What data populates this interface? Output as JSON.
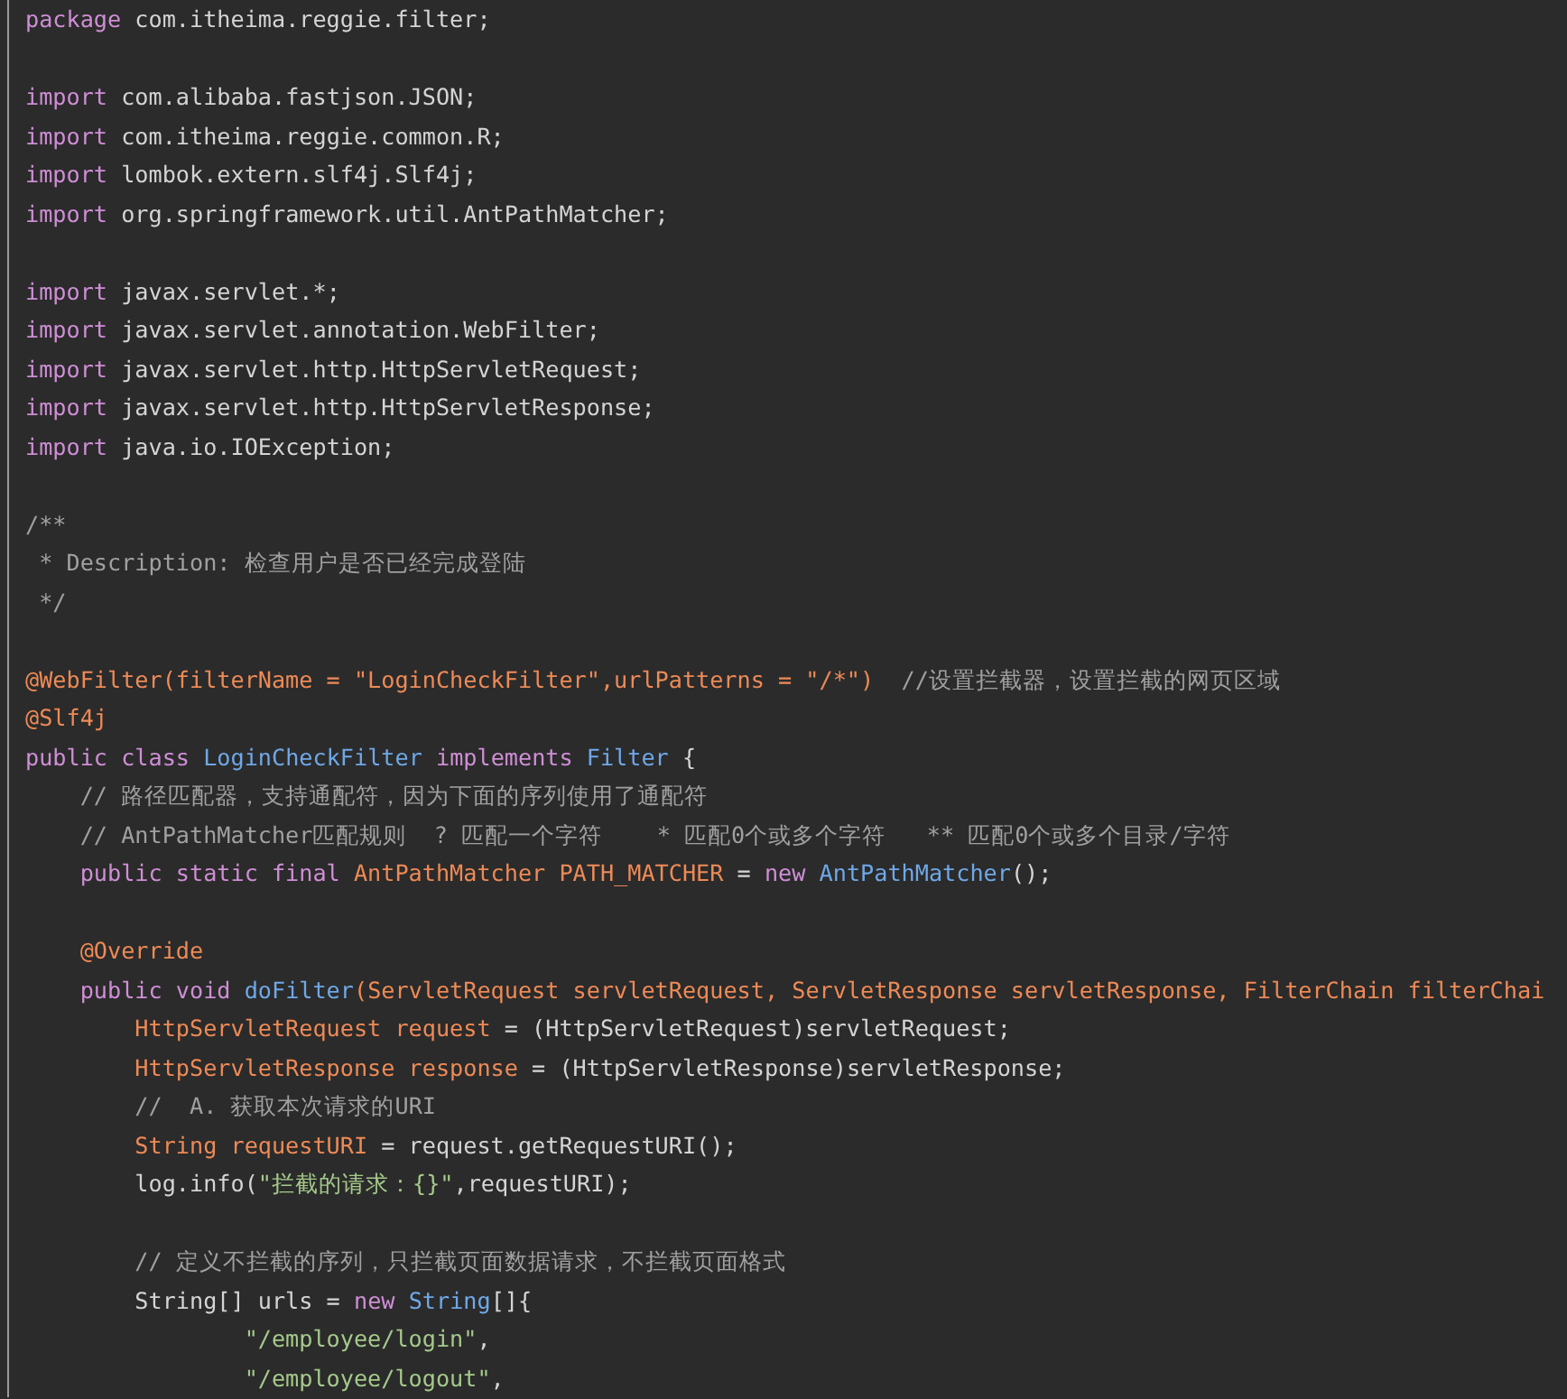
{
  "editor": {
    "lines": [
      {
        "kind": "code",
        "tokens": [
          {
            "text": "package",
            "kind": "kw"
          },
          {
            "text": " com.itheima.reggie.filter;",
            "kind": "plain"
          }
        ]
      },
      {
        "kind": "blank"
      },
      {
        "kind": "code",
        "tokens": [
          {
            "text": "import",
            "kind": "kw"
          },
          {
            "text": " com.alibaba.fastjson.JSON;",
            "kind": "plain"
          }
        ]
      },
      {
        "kind": "code",
        "tokens": [
          {
            "text": "import",
            "kind": "kw"
          },
          {
            "text": " com.itheima.reggie.common.R;",
            "kind": "plain"
          }
        ]
      },
      {
        "kind": "code",
        "tokens": [
          {
            "text": "import",
            "kind": "kw"
          },
          {
            "text": " lombok.extern.slf4j.Slf4j;",
            "kind": "plain"
          }
        ]
      },
      {
        "kind": "code",
        "tokens": [
          {
            "text": "import",
            "kind": "kw"
          },
          {
            "text": " org.springframework.util.AntPathMatcher;",
            "kind": "plain"
          }
        ]
      },
      {
        "kind": "blank"
      },
      {
        "kind": "code",
        "tokens": [
          {
            "text": "import",
            "kind": "kw"
          },
          {
            "text": " javax.servlet.*;",
            "kind": "plain"
          }
        ]
      },
      {
        "kind": "code",
        "tokens": [
          {
            "text": "import",
            "kind": "kw"
          },
          {
            "text": " javax.servlet.annotation.WebFilter;",
            "kind": "plain"
          }
        ]
      },
      {
        "kind": "code",
        "tokens": [
          {
            "text": "import",
            "kind": "kw"
          },
          {
            "text": " javax.servlet.http.HttpServletRequest;",
            "kind": "plain"
          }
        ]
      },
      {
        "kind": "code",
        "tokens": [
          {
            "text": "import",
            "kind": "kw"
          },
          {
            "text": " javax.servlet.http.HttpServletResponse;",
            "kind": "plain"
          }
        ]
      },
      {
        "kind": "code",
        "tokens": [
          {
            "text": "import",
            "kind": "kw"
          },
          {
            "text": " java.io.IOException;",
            "kind": "plain"
          }
        ]
      },
      {
        "kind": "blank"
      },
      {
        "kind": "code",
        "tokens": [
          {
            "text": "/**",
            "kind": "cmt"
          }
        ]
      },
      {
        "kind": "code",
        "tokens": [
          {
            "text": " * Description: 检查用户是否已经完成登陆",
            "kind": "cmt"
          }
        ]
      },
      {
        "kind": "code",
        "tokens": [
          {
            "text": " */",
            "kind": "cmt"
          }
        ]
      },
      {
        "kind": "blank"
      },
      {
        "kind": "code",
        "tokens": [
          {
            "text": "@WebFilter(filterName = \"LoginCheckFilter\",urlPatterns = \"/*\")",
            "kind": "decl"
          },
          {
            "text": "  //设置拦截器，设置拦截的网页区域",
            "kind": "cmt"
          }
        ]
      },
      {
        "kind": "code",
        "tokens": [
          {
            "text": "@Slf4j",
            "kind": "decl"
          }
        ]
      },
      {
        "kind": "code",
        "tokens": [
          {
            "text": "public class",
            "kind": "kw"
          },
          {
            "text": " LoginCheckFilter",
            "kind": "type"
          },
          {
            "text": " implements",
            "kind": "kw"
          },
          {
            "text": " Filter",
            "kind": "type"
          },
          {
            "text": " {",
            "kind": "plain"
          }
        ]
      },
      {
        "kind": "code",
        "tokens": [
          {
            "text": "    // 路径匹配器，支持通配符，因为下面的序列使用了通配符",
            "kind": "cmt"
          }
        ]
      },
      {
        "kind": "code",
        "tokens": [
          {
            "text": "    // AntPathMatcher匹配规则  ? 匹配一个字符    * 匹配0个或多个字符   ** 匹配0个或多个目录/字符",
            "kind": "cmt"
          }
        ]
      },
      {
        "kind": "code",
        "tokens": [
          {
            "text": "    public static final",
            "kind": "kw"
          },
          {
            "text": " AntPathMatcher PATH_MATCHER",
            "kind": "decl"
          },
          {
            "text": " = ",
            "kind": "plain"
          },
          {
            "text": "new",
            "kind": "kw"
          },
          {
            "text": " AntPathMatcher",
            "kind": "type"
          },
          {
            "text": "();",
            "kind": "plain"
          }
        ]
      },
      {
        "kind": "blank"
      },
      {
        "kind": "code",
        "tokens": [
          {
            "text": "    @Override",
            "kind": "decl"
          }
        ]
      },
      {
        "kind": "code",
        "tokens": [
          {
            "text": "    public void",
            "kind": "kw"
          },
          {
            "text": " doFilter",
            "kind": "type"
          },
          {
            "text": "(ServletRequest servletRequest, ServletResponse servletResponse, FilterChain filterChai",
            "kind": "decl"
          }
        ]
      },
      {
        "kind": "code",
        "tokens": [
          {
            "text": "        HttpServletRequest request",
            "kind": "decl"
          },
          {
            "text": " = (HttpServletRequest)servletRequest;",
            "kind": "plain"
          }
        ]
      },
      {
        "kind": "code",
        "tokens": [
          {
            "text": "        HttpServletResponse response",
            "kind": "decl"
          },
          {
            "text": " = (HttpServletResponse)servletResponse;",
            "kind": "plain"
          }
        ]
      },
      {
        "kind": "code",
        "tokens": [
          {
            "text": "        //  A. 获取本次请求的URI",
            "kind": "cmt"
          }
        ]
      },
      {
        "kind": "code",
        "tokens": [
          {
            "text": "        String requestURI",
            "kind": "decl"
          },
          {
            "text": " = request.getRequestURI();",
            "kind": "plain"
          }
        ]
      },
      {
        "kind": "code",
        "tokens": [
          {
            "text": "        log.info(",
            "kind": "plain"
          },
          {
            "text": "\"拦截的请求：{}\"",
            "kind": "str"
          },
          {
            "text": ",requestURI);",
            "kind": "plain"
          }
        ]
      },
      {
        "kind": "blank"
      },
      {
        "kind": "code",
        "tokens": [
          {
            "text": "        // 定义不拦截的序列，只拦截页面数据请求，不拦截页面格式",
            "kind": "cmt"
          }
        ]
      },
      {
        "kind": "code",
        "tokens": [
          {
            "text": "        String[] urls = ",
            "kind": "plain"
          },
          {
            "text": "new",
            "kind": "kw"
          },
          {
            "text": " String",
            "kind": "type"
          },
          {
            "text": "[]{",
            "kind": "plain"
          }
        ]
      },
      {
        "kind": "code",
        "tokens": [
          {
            "text": "                \"/employee/login\"",
            "kind": "str"
          },
          {
            "text": ",",
            "kind": "plain"
          }
        ]
      },
      {
        "kind": "code",
        "tokens": [
          {
            "text": "                \"/employee/logout\"",
            "kind": "str"
          },
          {
            "text": ",",
            "kind": "plain"
          }
        ]
      }
    ]
  }
}
